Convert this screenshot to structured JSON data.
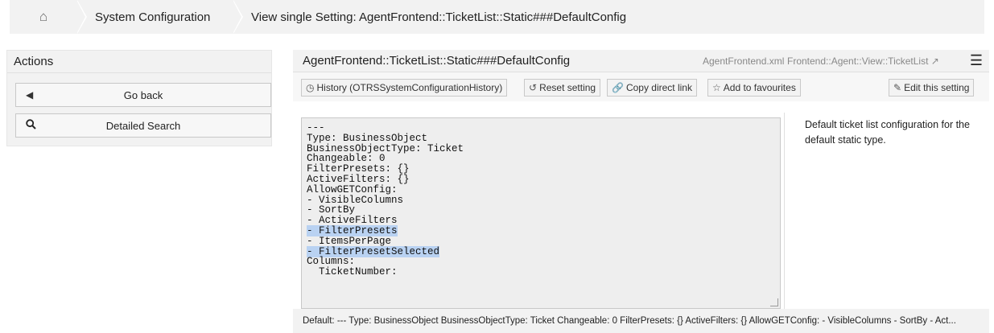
{
  "breadcrumb": {
    "home_icon": "home-icon",
    "items": [
      "System Configuration",
      "View single Setting: AgentFrontend::TicketList::Static###DefaultConfig"
    ]
  },
  "actions": {
    "title": "Actions",
    "go_back": "Go back",
    "detailed_search": "Detailed Search"
  },
  "setting": {
    "name": "AgentFrontend::TicketList::Static###DefaultConfig",
    "file": "AgentFrontend.xml",
    "navigation": "Frontend::Agent::View::TicketList",
    "external_icon": "external-link-icon",
    "menu_icon": "hamburger-icon"
  },
  "toolbar": {
    "history": "History (OTRSSystemConfigurationHistory)",
    "reset": "Reset setting",
    "copy_link": "Copy direct link",
    "favourites": "Add to favourites",
    "edit": "Edit this setting"
  },
  "editor": {
    "lines": [
      "---",
      "Type: BusinessObject",
      "BusinessObjectType: Ticket",
      "Changeable: 0",
      "FilterPresets: {}",
      "ActiveFilters: {}",
      "AllowGETConfig:",
      "- VisibleColumns",
      "- SortBy",
      "- ActiveFilters",
      "- FilterPresets",
      "- ItemsPerPage",
      "- FilterPresetSelected",
      "Columns:",
      "  TicketNumber:"
    ],
    "highlighted_lines": [
      10,
      12
    ]
  },
  "description": "Default ticket list configuration for the default static type.",
  "footer": {
    "default_text": "Default: --- Type: BusinessObject BusinessObjectType: Ticket Changeable: 0 FilterPresets: {} ActiveFilters: {} AllowGETConfig: - VisibleColumns - SortBy - Act..."
  }
}
